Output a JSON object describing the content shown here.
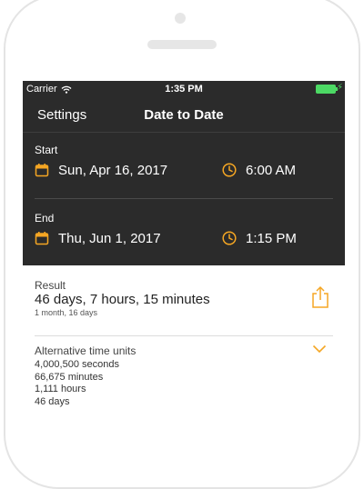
{
  "status_bar": {
    "carrier": "Carrier",
    "time": "1:35 PM"
  },
  "nav": {
    "back_label": "Settings",
    "title": "Date to Date"
  },
  "start": {
    "label": "Start",
    "date": "Sun, Apr 16, 2017",
    "time": "6:00 AM"
  },
  "end": {
    "label": "End",
    "date": "Thu, Jun 1, 2017",
    "time": "1:15 PM"
  },
  "result": {
    "label": "Result",
    "main": "46 days, 7 hours, 15 minutes",
    "sub": "1 month, 16 days"
  },
  "alternative": {
    "label": "Alternative time units",
    "units": [
      "4,000,500 seconds",
      "66,675 minutes",
      "1,111 hours",
      "46 days"
    ]
  },
  "colors": {
    "accent": "#f5a623",
    "dark_bg": "#2b2b2b",
    "battery": "#4cd964"
  },
  "icons": {
    "wifi": "wifi-icon",
    "battery": "battery-icon",
    "calendar": "calendar-icon",
    "clock": "clock-icon",
    "share": "share-icon",
    "chevron": "chevron-down-icon"
  }
}
